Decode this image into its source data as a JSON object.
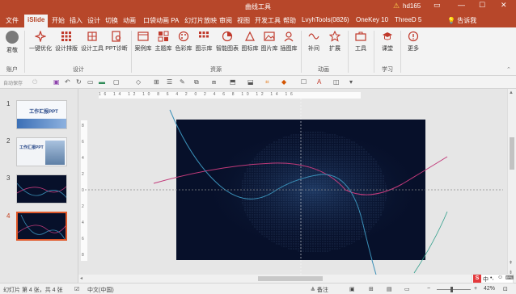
{
  "window": {
    "title": "曲线工具",
    "user": "hd165"
  },
  "tabs": [
    "文件",
    "iSlide",
    "开始",
    "插入",
    "设计",
    "切换",
    "动画",
    "口袋动画 PA",
    "幻灯片放映",
    "审阅",
    "视图",
    "开发工具",
    "帮助",
    "LvyhTools(0826)",
    "OneKey 10",
    "ThreeD 5"
  ],
  "tell_me": "告诉我",
  "ribbon": {
    "account": {
      "label": "君敬",
      "group": "账户"
    },
    "design": {
      "buttons": [
        "一键优化",
        "设计排版",
        "设计工具",
        "PPT诊断"
      ],
      "group": "设计"
    },
    "resources": {
      "buttons": [
        "案例库",
        "主题库",
        "色彩库",
        "图示库",
        "智能图表",
        "图标库",
        "图片库",
        "插图库"
      ],
      "group": "资源"
    },
    "animation": {
      "buttons": [
        "补间",
        "扩展"
      ],
      "group": "动画"
    },
    "tools": {
      "buttons": [
        "工具"
      ]
    },
    "learning": {
      "buttons": [
        "课堂"
      ],
      "group": "学习"
    },
    "more": {
      "buttons": [
        "更多"
      ]
    }
  },
  "qat": {
    "autosave": "自动保存"
  },
  "ruler": {
    "h": "16 14 12 10 8 6 4 2 0 2 4 6 8 10 12 14 16",
    "v": [
      "8",
      "6",
      "4",
      "2",
      "0",
      "2",
      "4",
      "6",
      "8"
    ]
  },
  "slides": [
    {
      "number": "1",
      "title": "工作汇报PPT"
    },
    {
      "number": "2",
      "title": "工作汇报PPT"
    },
    {
      "number": "3"
    },
    {
      "number": "4"
    }
  ],
  "status": {
    "slide": "幻灯片 第 4 张，共 4 张",
    "language": "中文(中国)",
    "notes": "备注",
    "zoom": "42%"
  },
  "ime": {
    "logo": "S",
    "mode": "中"
  },
  "colors": {
    "accent": "#b7472a",
    "slide_bg": "#07102a"
  }
}
